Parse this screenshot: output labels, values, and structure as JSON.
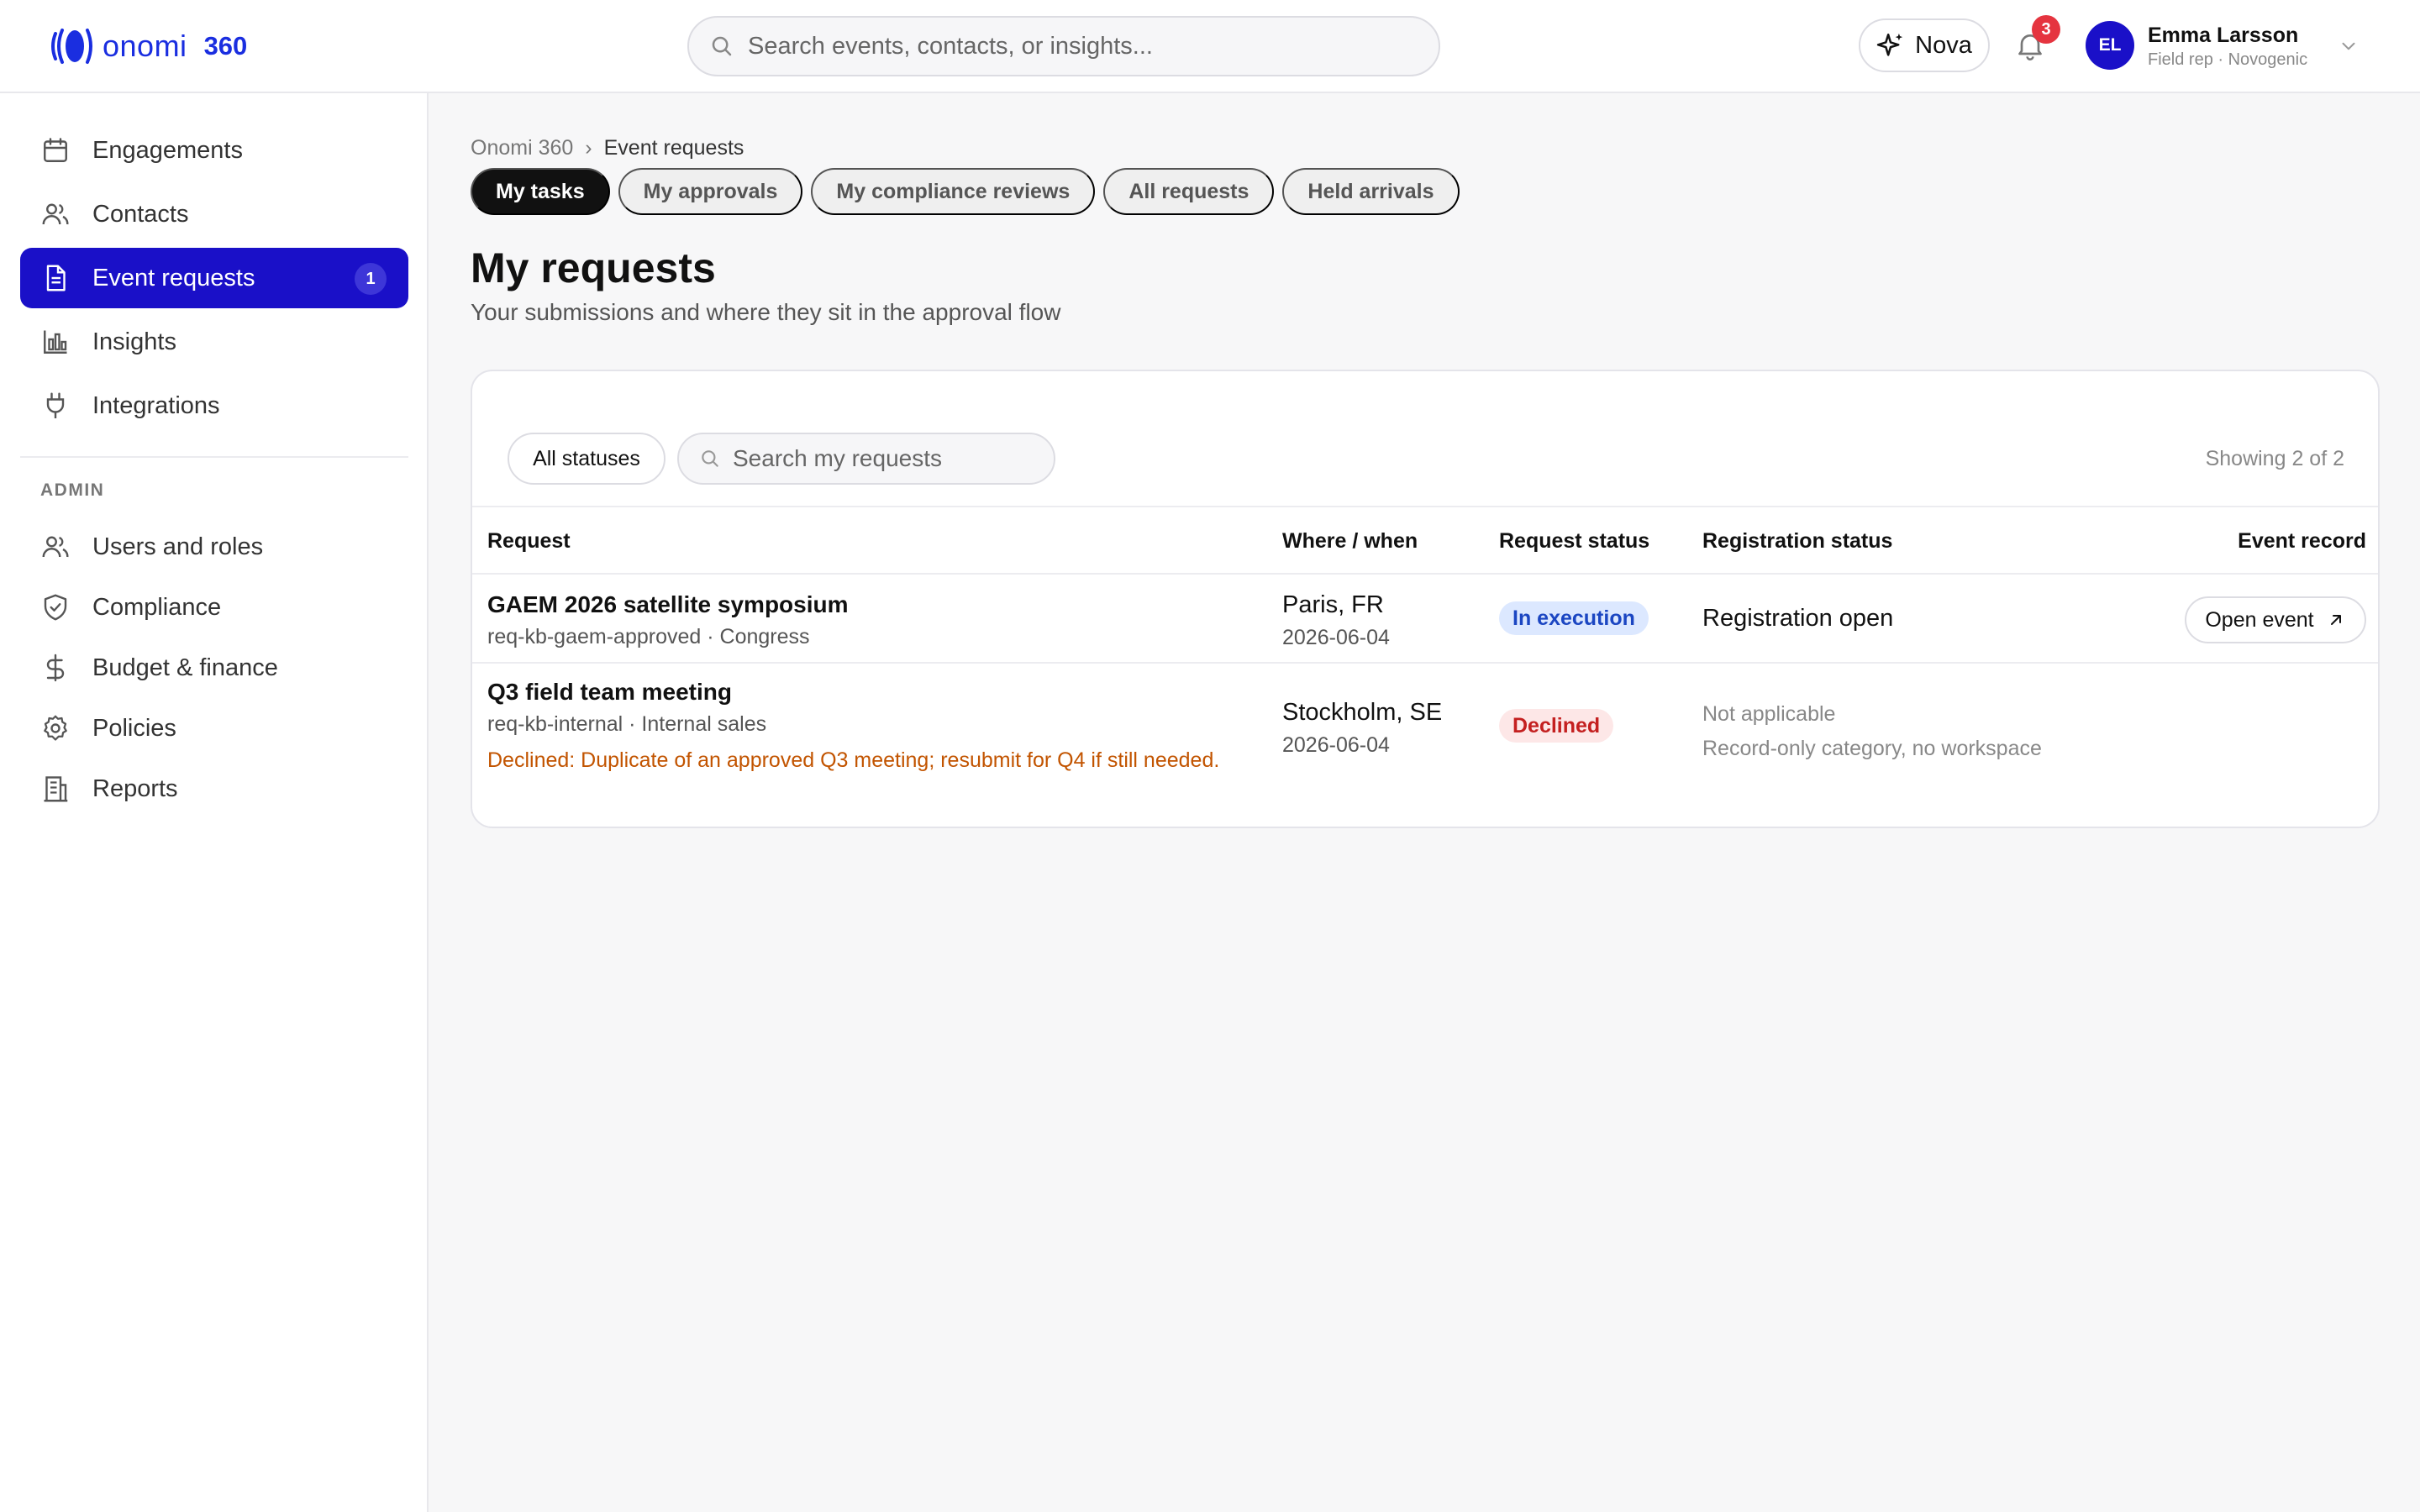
{
  "header": {
    "logo_text": "onomi",
    "logo_suffix": "360",
    "search_placeholder": "Search events, contacts, or insights...",
    "nova_label": "Nova",
    "notification_count": "3",
    "user": {
      "initials": "EL",
      "name": "Emma Larsson",
      "role": "Field rep · Novogenic"
    }
  },
  "sidebar": {
    "items": [
      {
        "label": "Engagements",
        "icon": "calendar-icon"
      },
      {
        "label": "Contacts",
        "icon": "users-icon"
      },
      {
        "label": "Event requests",
        "icon": "document-icon",
        "badge": "1",
        "active": true
      },
      {
        "label": "Insights",
        "icon": "bar-chart-icon"
      },
      {
        "label": "Integrations",
        "icon": "plug-icon"
      }
    ],
    "admin_label": "ADMIN",
    "admin_items": [
      {
        "label": "Users and roles",
        "icon": "users-icon"
      },
      {
        "label": "Compliance",
        "icon": "shield-check-icon"
      },
      {
        "label": "Budget & finance",
        "icon": "dollar-icon"
      },
      {
        "label": "Policies",
        "icon": "gear-icon"
      },
      {
        "label": "Reports",
        "icon": "building-icon"
      }
    ]
  },
  "breadcrumb": {
    "root": "Onomi 360",
    "separator": "›",
    "current": "Event requests"
  },
  "tabs": [
    {
      "label": "My tasks",
      "active": true
    },
    {
      "label": "My approvals"
    },
    {
      "label": "My compliance reviews"
    },
    {
      "label": "All requests"
    },
    {
      "label": "Held arrivals"
    }
  ],
  "page": {
    "title": "My requests",
    "subtitle": "Your submissions and where they sit in the approval flow"
  },
  "filters": {
    "status_label": "All statuses",
    "search_placeholder": "Search my requests",
    "showing": "Showing 2 of 2"
  },
  "table": {
    "columns": [
      "Request",
      "Where / when",
      "Request status",
      "Registration status",
      "Event record"
    ],
    "rows": [
      {
        "title": "GAEM 2026 satellite symposium",
        "meta": "req-kb-gaem-approved · Congress",
        "location": "Paris, FR",
        "date": "2026-06-04",
        "status": "In execution",
        "registration": "Registration open",
        "action": "Open event"
      },
      {
        "title": "Q3 field team meeting",
        "meta": "req-kb-internal · Internal sales",
        "decline_note": "Declined: Duplicate of an approved Q3 meeting; resubmit for Q4 if still needed.",
        "location": "Stockholm, SE",
        "date": "2026-06-04",
        "status": "Declined",
        "registration": "Not applicable",
        "registration_note": "Record-only category, no workspace"
      }
    ]
  },
  "colors": {
    "brand": "#1a2ee0",
    "active_nav": "#1a10c8",
    "status_exec_bg": "#dce8ff",
    "status_declined_bg": "#fde7e7",
    "decline_text": "#c25400"
  }
}
